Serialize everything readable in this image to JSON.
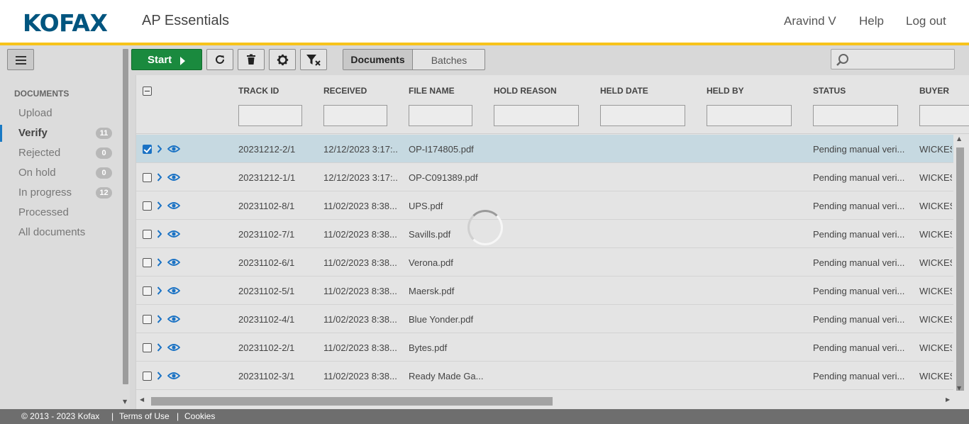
{
  "header": {
    "logo": "KOFAX",
    "app_title": "AP Essentials",
    "user": "Aravind V",
    "help": "Help",
    "logout": "Log out",
    "accent_color": "#f7c31b",
    "logo_color": "#00557f"
  },
  "sidebar": {
    "heading": "DOCUMENTS",
    "items": [
      {
        "label": "Upload",
        "count": null
      },
      {
        "label": "Verify",
        "count": "11"
      },
      {
        "label": "Rejected",
        "count": "0"
      },
      {
        "label": "On hold",
        "count": "0"
      },
      {
        "label": "In progress",
        "count": "12"
      },
      {
        "label": "Processed",
        "count": null
      },
      {
        "label": "All documents",
        "count": null
      }
    ]
  },
  "toolbar": {
    "start_label": "Start",
    "refresh_icon": "refresh-icon",
    "delete_icon": "trash-icon",
    "settings_icon": "gear-icon",
    "clear_filter_icon": "clear-filter-icon",
    "tab_documents": "Documents",
    "tab_batches": "Batches",
    "search_placeholder": "",
    "start_color": "#1a8a3e"
  },
  "grid": {
    "columns": [
      "TRACK ID",
      "RECEIVED",
      "FILE NAME",
      "HOLD REASON",
      "HELD DATE",
      "HELD BY",
      "STATUS",
      "BUYER"
    ],
    "rows": [
      {
        "checked": true,
        "track_id": "20231212-2/1",
        "received": "12/12/2023 3:17:...",
        "file_name": "OP-I174805.pdf",
        "status": "Pending manual veri...",
        "buyer": "WICKES"
      },
      {
        "checked": false,
        "track_id": "20231212-1/1",
        "received": "12/12/2023 3:17:...",
        "file_name": "OP-C091389.pdf",
        "status": "Pending manual veri...",
        "buyer": "WICKES"
      },
      {
        "checked": false,
        "track_id": "20231102-8/1",
        "received": "11/02/2023 8:38...",
        "file_name": "UPS.pdf",
        "status": "Pending manual veri...",
        "buyer": "WICKES"
      },
      {
        "checked": false,
        "track_id": "20231102-7/1",
        "received": "11/02/2023 8:38...",
        "file_name": "Savills.pdf",
        "status": "Pending manual veri...",
        "buyer": "WICKES"
      },
      {
        "checked": false,
        "track_id": "20231102-6/1",
        "received": "11/02/2023 8:38...",
        "file_name": "Verona.pdf",
        "status": "Pending manual veri...",
        "buyer": "WICKES"
      },
      {
        "checked": false,
        "track_id": "20231102-5/1",
        "received": "11/02/2023 8:38...",
        "file_name": "Maersk.pdf",
        "status": "Pending manual veri...",
        "buyer": "WICKES"
      },
      {
        "checked": false,
        "track_id": "20231102-4/1",
        "received": "11/02/2023 8:38...",
        "file_name": "Blue Yonder.pdf",
        "status": "Pending manual veri...",
        "buyer": "WICKES"
      },
      {
        "checked": false,
        "track_id": "20231102-2/1",
        "received": "11/02/2023 8:38...",
        "file_name": "Bytes.pdf",
        "status": "Pending manual veri...",
        "buyer": "WICKES"
      },
      {
        "checked": false,
        "track_id": "20231102-3/1",
        "received": "11/02/2023 8:38...",
        "file_name": "Ready Made Ga...",
        "status": "Pending manual veri...",
        "buyer": "WICKES"
      }
    ],
    "selected_row_color": "#c6d9e1"
  },
  "footer": {
    "copyright": "© 2013 - 2023 Kofax",
    "sep": "|",
    "terms": "Terms of Use",
    "cookies": "Cookies"
  }
}
